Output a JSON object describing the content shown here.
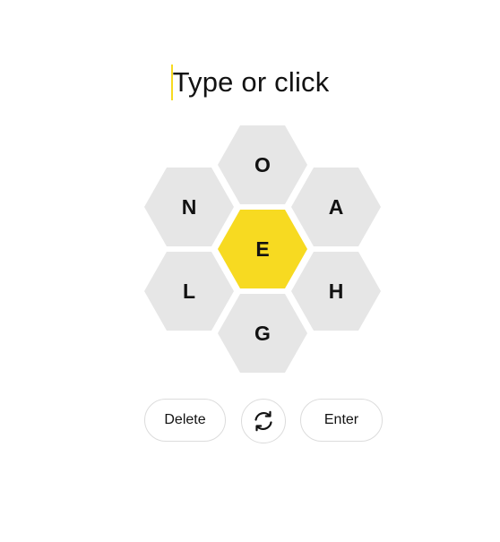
{
  "input": {
    "placeholder": "Type or click",
    "caret_color": "#f7da21"
  },
  "hive": {
    "center_letter": "E",
    "outer_letters": [
      "O",
      "A",
      "H",
      "G",
      "L",
      "N"
    ],
    "center_color": "#f7da21",
    "outer_color": "#e6e6e6"
  },
  "controls": {
    "delete_label": "Delete",
    "shuffle_icon": "shuffle-icon",
    "enter_label": "Enter"
  }
}
